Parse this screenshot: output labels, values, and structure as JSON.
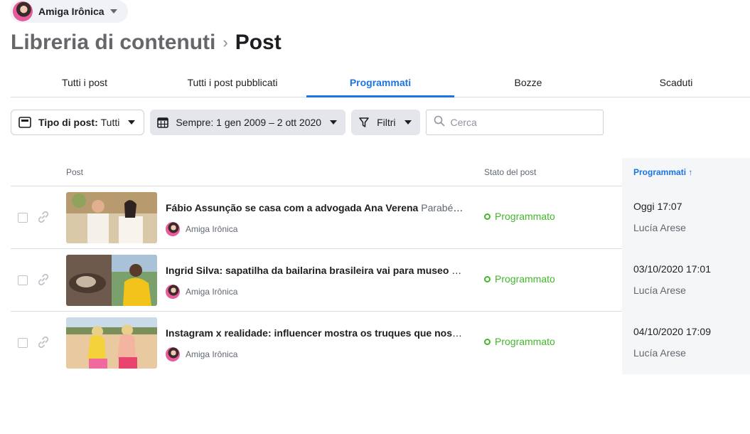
{
  "page": {
    "name": "Amiga Irônica"
  },
  "breadcrumb": {
    "parent": "Libreria di contenuti",
    "current": "Post"
  },
  "tabs": [
    {
      "label": "Tutti i post",
      "active": false
    },
    {
      "label": "Tutti i post pubblicati",
      "active": false
    },
    {
      "label": "Programmati",
      "active": true
    },
    {
      "label": "Bozze",
      "active": false
    },
    {
      "label": "Scaduti",
      "active": false
    }
  ],
  "filters": {
    "post_type_label": "Tipo di post:",
    "post_type_value": "Tutti",
    "date_range": "Sempre: 1 gen 2009 – 2 ott 2020",
    "filters_label": "Filtri",
    "search_placeholder": "Cerca"
  },
  "table": {
    "headers": {
      "post": "Post",
      "status": "Stato del post",
      "scheduled": "Programmati ↑"
    },
    "rows": [
      {
        "title": "Fábio Assunção se casa com a advogada Ana Verena",
        "description": " Parabéns aos noivos! Felicidades",
        "author": "Amiga Irônica",
        "status": "Programmato",
        "date": "Oggi 17:07",
        "scheduled_by": "Lucía Arese"
      },
      {
        "title": "Ingrid Silva: sapatilha da bailarina brasileira vai para museo americano",
        "description": "",
        "author": "Amiga Irônica",
        "status": "Programmato",
        "date": "03/10/2020 17:01",
        "scheduled_by": "Lucía Arese"
      },
      {
        "title": "Instagram x realidade: influencer mostra os truques que nos enganam",
        "description": "",
        "author": "Amiga Irônica",
        "status": "Programmato",
        "date": "04/10/2020 17:09",
        "scheduled_by": "Lucía Arese"
      }
    ]
  },
  "colors": {
    "accent": "#1b74e4",
    "status_green": "#42b72a"
  }
}
